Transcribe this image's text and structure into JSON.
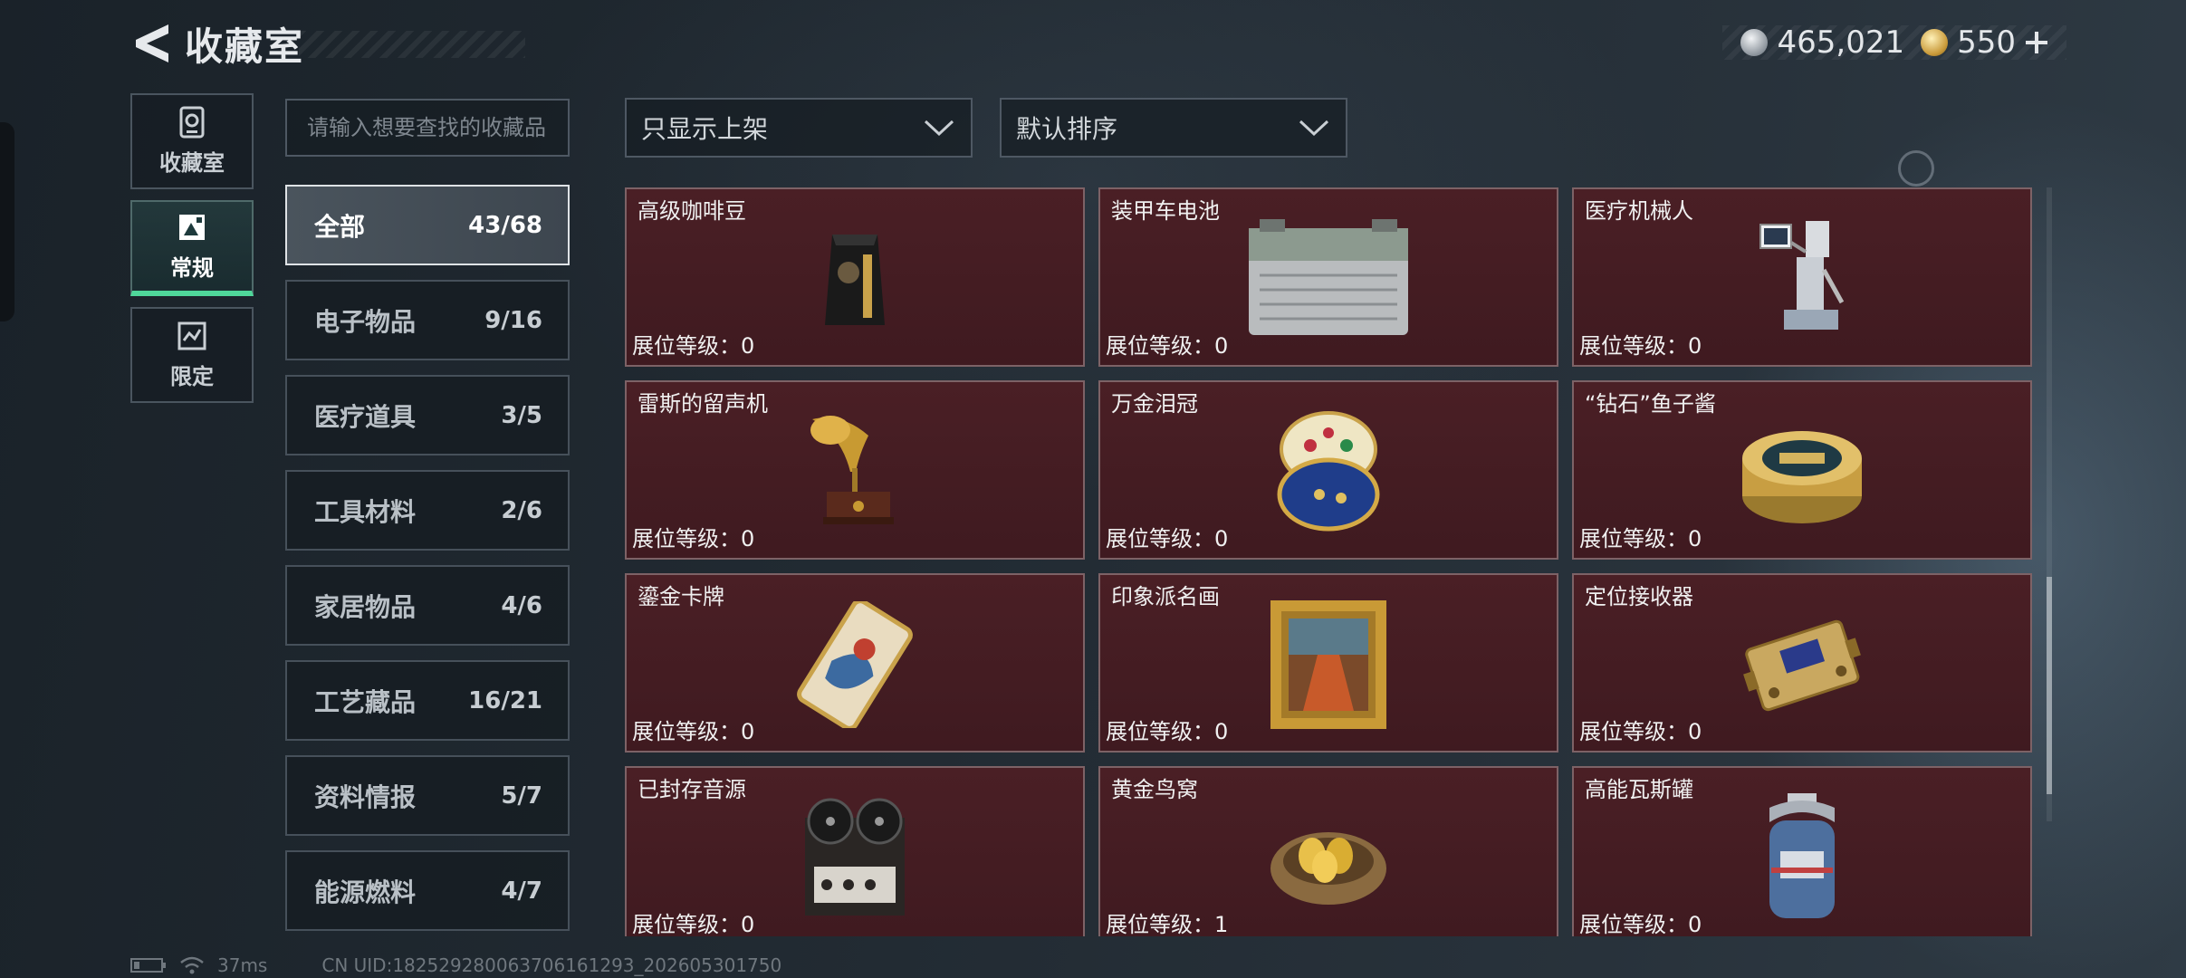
{
  "header": {
    "title": "收藏室",
    "currency_silver": "465,021",
    "currency_gold": "550"
  },
  "nav": {
    "items": [
      {
        "label": "收藏室",
        "icon": "collection-room-icon"
      },
      {
        "label": "常规",
        "icon": "regular-icon"
      },
      {
        "label": "限定",
        "icon": "limited-icon"
      }
    ]
  },
  "search": {
    "placeholder": "请输入想要查找的收藏品"
  },
  "categories": [
    {
      "name": "全部",
      "count": "43/68"
    },
    {
      "name": "电子物品",
      "count": "9/16"
    },
    {
      "name": "医疗道具",
      "count": "3/5"
    },
    {
      "name": "工具材料",
      "count": "2/6"
    },
    {
      "name": "家居物品",
      "count": "4/6"
    },
    {
      "name": "工艺藏品",
      "count": "16/21"
    },
    {
      "name": "资料情报",
      "count": "5/7"
    },
    {
      "name": "能源燃料",
      "count": "4/7"
    }
  ],
  "filters": {
    "shelf_filter": "只显示上架",
    "sort": "默认排序"
  },
  "items": [
    {
      "name": "高级咖啡豆",
      "level": "展位等级：0",
      "icon": "coffee-bag-icon"
    },
    {
      "name": "装甲车电池",
      "level": "展位等级：0",
      "icon": "battery-icon"
    },
    {
      "name": "医疗机械人",
      "level": "展位等级：0",
      "icon": "medical-robot-icon"
    },
    {
      "name": "雷斯的留声机",
      "level": "展位等级：0",
      "icon": "gramophone-icon"
    },
    {
      "name": "万金泪冠",
      "level": "展位等级：0",
      "icon": "jeweled-egg-icon"
    },
    {
      "name": "“钻石”鱼子酱",
      "level": "展位等级：0",
      "icon": "caviar-tin-icon"
    },
    {
      "name": "鎏金卡牌",
      "level": "展位等级：0",
      "icon": "gilded-card-icon"
    },
    {
      "name": "印象派名画",
      "level": "展位等级：0",
      "icon": "framed-painting-icon"
    },
    {
      "name": "定位接收器",
      "level": "展位等级：0",
      "icon": "receiver-device-icon"
    },
    {
      "name": "已封存音源",
      "level": "展位等级：0",
      "icon": "reel-recorder-icon"
    },
    {
      "name": "黄金鸟窝",
      "level": "展位等级：1",
      "icon": "golden-nest-icon"
    },
    {
      "name": "高能瓦斯罐",
      "level": "展位等级：0",
      "icon": "gas-canister-icon"
    }
  ],
  "footer": {
    "ping": "37ms",
    "uid": "CN UID:182529280063706161293_202605301750"
  },
  "colors": {
    "accent_green": "#4fd79a",
    "card_bg": "#4a1f25",
    "card_border": "#7d6266"
  }
}
